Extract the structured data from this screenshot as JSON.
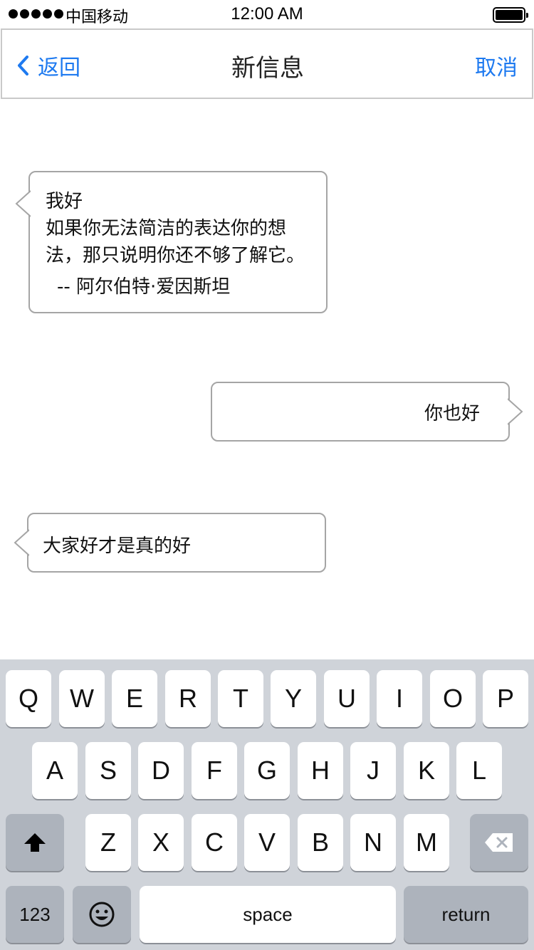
{
  "status_bar": {
    "carrier": "中国移动",
    "time": "12:00 AM"
  },
  "nav": {
    "back_label": "返回",
    "title": "新信息",
    "cancel_label": "取消"
  },
  "messages": [
    {
      "direction": "incoming",
      "text": "我好\n如果你无法简洁的表达你的想\n法，那只说明你还不够了解它。",
      "signature": "-- 阿尔伯特·爱因斯坦"
    },
    {
      "direction": "outgoing",
      "text": "你也好"
    },
    {
      "direction": "incoming",
      "text": "大家好才是真的好"
    }
  ],
  "keyboard": {
    "row1": [
      "Q",
      "W",
      "E",
      "R",
      "T",
      "Y",
      "U",
      "I",
      "O",
      "P"
    ],
    "row2": [
      "A",
      "S",
      "D",
      "F",
      "G",
      "H",
      "J",
      "K",
      "L"
    ],
    "row3": [
      "Z",
      "X",
      "C",
      "V",
      "B",
      "N",
      "M"
    ],
    "numbers_label": "123",
    "space_label": "space",
    "return_label": "return"
  },
  "colors": {
    "accent": "#1e7af0",
    "keyboard_bg": "#cfd3d9",
    "bubble_border": "#a5a5a5"
  }
}
